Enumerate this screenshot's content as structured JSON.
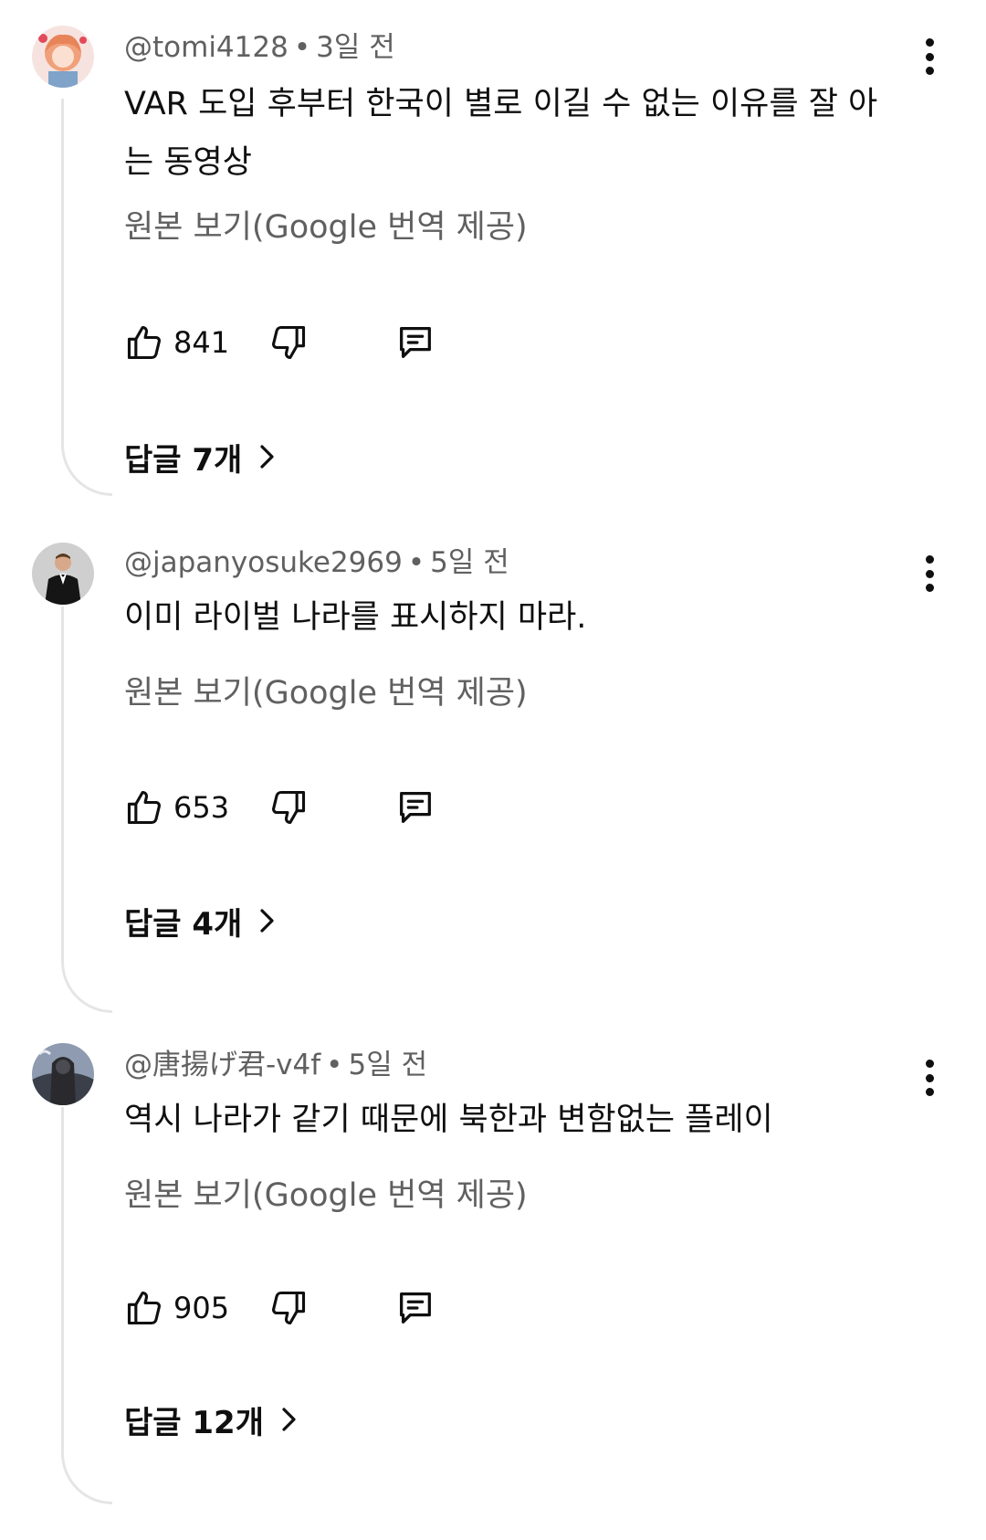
{
  "comments": [
    {
      "author": "@tomi4128",
      "time": "3일 전",
      "text": "VAR 도입 후부터 한국이 별로 이길 수 없는 이유를 잘 아는 동영상",
      "translate_label": "원본 보기(Google 번역 제공)",
      "likes": "841",
      "replies_label": "답글 7개",
      "avatar_icon": "anime-avatar"
    },
    {
      "author": "@japanyosuke2969",
      "time": "5일 전",
      "text": "이미 라이벌  나라를 표시하지 마라.",
      "translate_label": "원본 보기(Google 번역 제공)",
      "likes": "653",
      "replies_label": "답글 4개",
      "avatar_icon": "man-in-suit-avatar"
    },
    {
      "author": "@唐揚げ君-v4f",
      "time": "5일 전",
      "text": "역시 나라가 같기 때문에 북한과 변함없는 플레이",
      "translate_label": "원본 보기(Google 번역 제공)",
      "likes": "905",
      "replies_label": "답글 12개",
      "avatar_icon": "dark-figure-avatar"
    }
  ],
  "meta_separator": "•",
  "icons": {
    "like": "thumbs-up-icon",
    "dislike": "thumbs-down-icon",
    "reply": "comment-icon",
    "more": "more-vertical-icon",
    "replies": "chevron-right-icon"
  }
}
